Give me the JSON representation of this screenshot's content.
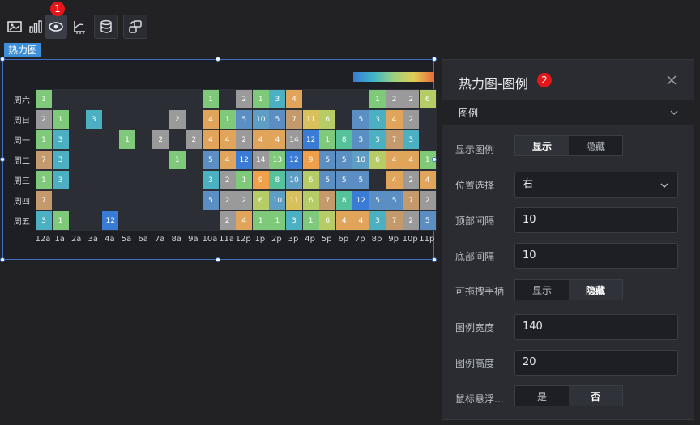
{
  "toolbar": {
    "buttons": [
      "image-icon",
      "bar-chart-icon",
      "heatmap-icon",
      "axis-icon",
      "database-icon",
      "interaction-icon"
    ],
    "badge1": "1"
  },
  "widget_tag": "热力图",
  "heatmap": {
    "days": [
      "周六",
      "周日",
      "周一",
      "周二",
      "周三",
      "周四",
      "周五"
    ],
    "hours": [
      "12a",
      "1a",
      "2a",
      "3a",
      "4a",
      "5a",
      "6a",
      "7a",
      "8a",
      "9a",
      "10a",
      "11a",
      "12p",
      "1p",
      "2p",
      "3p",
      "4p",
      "5p",
      "6p",
      "7p",
      "8p",
      "9p",
      "10p",
      "11p"
    ],
    "colors": [
      "#3a7bd5",
      "#5b8fc4",
      "#5e9ec4",
      "#4bb1c2",
      "#56c29b",
      "#7ec97a",
      "#b6cc67",
      "#d8c15d",
      "#e0a55a",
      "#f0a04b",
      "#9a9a9a",
      "#c49a6c"
    ],
    "rows": [
      [
        1,
        0,
        0,
        0,
        0,
        0,
        0,
        0,
        0,
        0,
        1,
        0,
        2,
        1,
        3,
        4,
        0,
        0,
        0,
        0,
        1,
        2,
        2,
        6
      ],
      [
        2,
        1,
        0,
        3,
        0,
        0,
        0,
        0,
        2,
        0,
        4,
        1,
        5,
        10,
        5,
        7,
        11,
        6,
        0,
        5,
        3,
        4,
        2,
        0
      ],
      [
        1,
        3,
        0,
        0,
        0,
        1,
        0,
        2,
        0,
        2,
        4,
        4,
        2,
        4,
        4,
        14,
        12,
        1,
        8,
        5,
        3,
        7,
        3,
        0
      ],
      [
        7,
        3,
        0,
        0,
        0,
        0,
        0,
        0,
        1,
        0,
        5,
        4,
        12,
        14,
        13,
        12,
        9,
        5,
        5,
        10,
        6,
        4,
        4,
        1
      ],
      [
        1,
        3,
        0,
        0,
        0,
        0,
        0,
        0,
        0,
        0,
        3,
        2,
        1,
        9,
        8,
        10,
        6,
        5,
        5,
        5,
        0,
        4,
        2,
        4
      ],
      [
        7,
        0,
        0,
        0,
        0,
        0,
        0,
        0,
        0,
        0,
        5,
        2,
        2,
        6,
        10,
        11,
        6,
        7,
        8,
        12,
        5,
        5,
        7,
        2
      ],
      [
        3,
        1,
        0,
        0,
        12,
        0,
        0,
        0,
        0,
        0,
        0,
        2,
        4,
        1,
        1,
        3,
        1,
        6,
        4,
        4,
        3,
        7,
        2,
        5
      ]
    ]
  },
  "panel": {
    "title": "热力图-图例",
    "badge2": "2",
    "section": "图例",
    "rows": {
      "show_legend": {
        "label": "显示图例",
        "opt_a": "显示",
        "opt_b": "隐藏"
      },
      "position": {
        "label": "位置选择",
        "value": "右"
      },
      "top_gap": {
        "label": "顶部间隔",
        "value": "10"
      },
      "bottom_gap": {
        "label": "底部间隔",
        "value": "10"
      },
      "drag_handle": {
        "label": "可拖拽手柄",
        "opt_a": "显示",
        "opt_b": "隐藏"
      },
      "legend_width": {
        "label": "图例宽度",
        "value": "140"
      },
      "legend_height": {
        "label": "图例高度",
        "value": "20"
      },
      "hover_float": {
        "label": "鼠标悬浮…",
        "opt_a": "是",
        "opt_b": "否"
      }
    }
  }
}
